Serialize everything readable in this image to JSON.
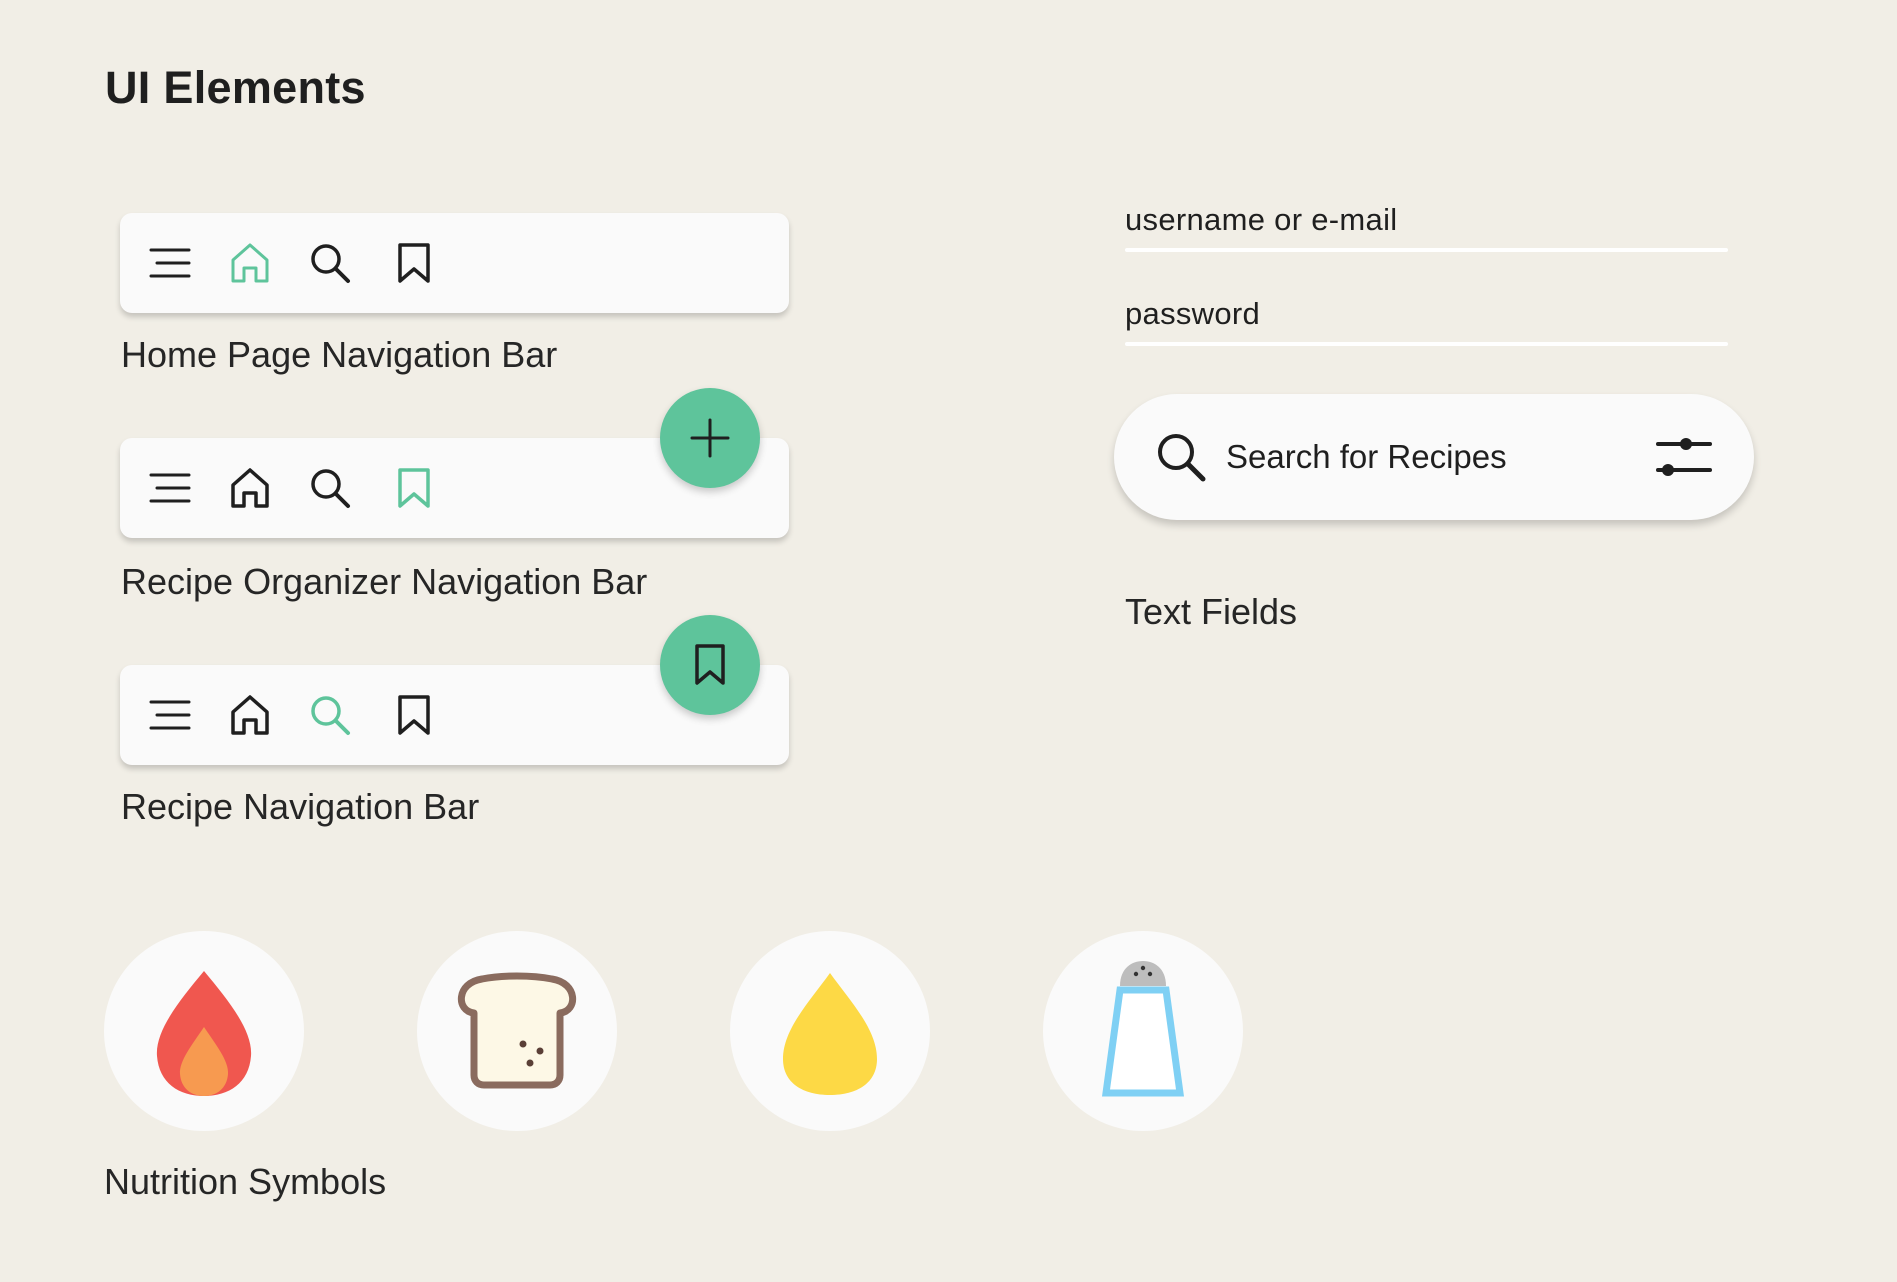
{
  "page": {
    "title": "UI Elements"
  },
  "colors": {
    "background": "#F1EEE6",
    "accent": "#5EC49B",
    "surface": "#FAFAFA",
    "icon_dark": "#1F1F1F"
  },
  "navbars": [
    {
      "label": "Home Page Navigation Bar",
      "active": "home-icon",
      "items": [
        "menu-icon",
        "home-icon",
        "search-icon",
        "bookmark-icon"
      ],
      "fab": null
    },
    {
      "label": "Recipe Organizer Navigation Bar",
      "active": "bookmark-icon",
      "items": [
        "menu-icon",
        "home-icon",
        "search-icon",
        "bookmark-icon"
      ],
      "fab": "plus-icon"
    },
    {
      "label": "Recipe Navigation Bar",
      "active": "search-icon",
      "items": [
        "menu-icon",
        "home-icon",
        "search-icon",
        "bookmark-icon"
      ],
      "fab": "bookmark-icon"
    }
  ],
  "text_fields": {
    "username_placeholder": "username or e-mail",
    "password_placeholder": "password",
    "search_placeholder": "Search for Recipes",
    "section_label": "Text Fields"
  },
  "nutrition": {
    "label": "Nutrition Symbols",
    "symbols": [
      "calories-flame-icon",
      "carbs-bread-icon",
      "fat-drop-icon",
      "sodium-salt-shaker-icon"
    ]
  }
}
